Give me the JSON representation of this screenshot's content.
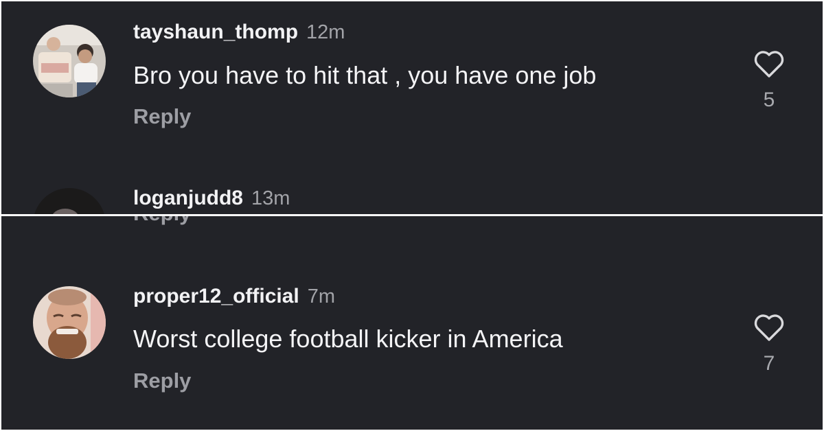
{
  "comments": [
    {
      "username": "tayshaun_thomp",
      "time": "12m",
      "text": "Bro you have to hit that , you have one job",
      "reply_label": "Reply",
      "likes": "5"
    },
    {
      "username": "loganjudd8",
      "time": "13m",
      "reply_label": "Reply"
    },
    {
      "username": "proper12_official",
      "time": "7m",
      "text": "Worst college football kicker in America",
      "reply_label": "Reply",
      "likes": "7"
    }
  ],
  "icons": {
    "like": "heart-outline-icon"
  },
  "colors": {
    "background": "#222328",
    "username": "#f2f2f4",
    "secondary_text": "#a2a3a8"
  }
}
